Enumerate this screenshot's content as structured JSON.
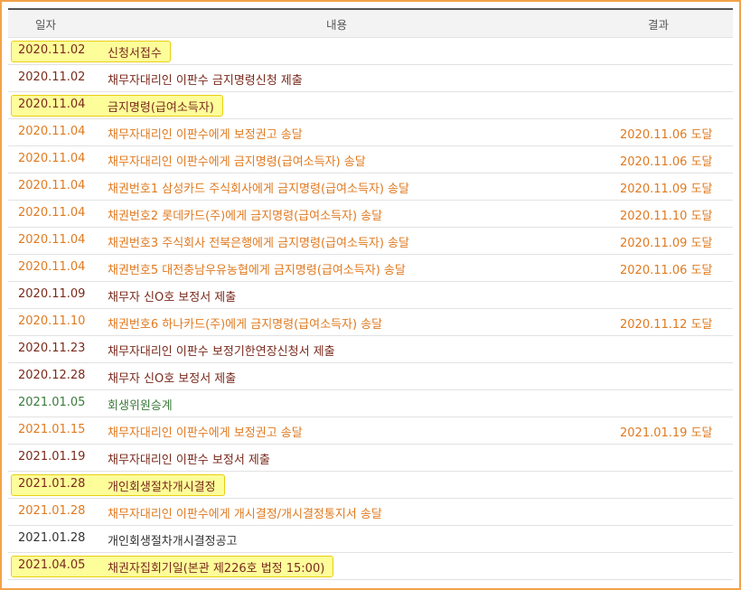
{
  "header": {
    "date": "일자",
    "content": "내용",
    "result": "결과"
  },
  "rows": [
    {
      "date": "2020.11.02",
      "content": "신청서접수",
      "result": "",
      "tone": "dark",
      "highlight": true
    },
    {
      "date": "2020.11.02",
      "content": "채무자대리인 이판수 금지명령신청 제출",
      "result": "",
      "tone": "dark",
      "highlight": false
    },
    {
      "date": "2020.11.04",
      "content": "금지명령(급여소득자)",
      "result": "",
      "tone": "dark",
      "highlight": true
    },
    {
      "date": "2020.11.04",
      "content": "채무자대리인 이판수에게 보정권고 송달",
      "result": "2020.11.06 도달",
      "tone": "orange",
      "highlight": false
    },
    {
      "date": "2020.11.04",
      "content": "채무자대리인 이판수에게 금지명령(급여소득자) 송달",
      "result": "2020.11.06 도달",
      "tone": "orange",
      "highlight": false
    },
    {
      "date": "2020.11.04",
      "content": "채권번호1 삼성카드 주식회사에게 금지명령(급여소득자) 송달",
      "result": "2020.11.09 도달",
      "tone": "orange",
      "highlight": false
    },
    {
      "date": "2020.11.04",
      "content": "채권번호2 롯데카드(주)에게 금지명령(급여소득자) 송달",
      "result": "2020.11.10 도달",
      "tone": "orange",
      "highlight": false
    },
    {
      "date": "2020.11.04",
      "content": "채권번호3 주식회사 전북은행에게 금지명령(급여소득자) 송달",
      "result": "2020.11.09 도달",
      "tone": "orange",
      "highlight": false
    },
    {
      "date": "2020.11.04",
      "content": "채권번호5 대전충남우유농협에게 금지명령(급여소득자) 송달",
      "result": "2020.11.06 도달",
      "tone": "orange",
      "highlight": false
    },
    {
      "date": "2020.11.09",
      "content": "채무자 신O호 보정서 제출",
      "result": "",
      "tone": "dark",
      "highlight": false
    },
    {
      "date": "2020.11.10",
      "content": "채권번호6 하나카드(주)에게 금지명령(급여소득자) 송달",
      "result": "2020.11.12 도달",
      "tone": "orange",
      "highlight": false
    },
    {
      "date": "2020.11.23",
      "content": "채무자대리인 이판수 보정기한연장신청서 제출",
      "result": "",
      "tone": "dark",
      "highlight": false
    },
    {
      "date": "2020.12.28",
      "content": "채무자 신O호 보정서 제출",
      "result": "",
      "tone": "dark",
      "highlight": false
    },
    {
      "date": "2021.01.05",
      "content": "회생위원승계",
      "result": "",
      "tone": "green",
      "highlight": false
    },
    {
      "date": "2021.01.15",
      "content": "채무자대리인 이판수에게 보정권고 송달",
      "result": "2021.01.19 도달",
      "tone": "orange",
      "highlight": false
    },
    {
      "date": "2021.01.19",
      "content": "채무자대리인 이판수 보정서 제출",
      "result": "",
      "tone": "dark",
      "highlight": false
    },
    {
      "date": "2021.01.28",
      "content": "개인회생절차개시결정",
      "result": "",
      "tone": "dark",
      "highlight": true
    },
    {
      "date": "2021.01.28",
      "content": "채무자대리인 이판수에게 개시결정/개시결정통지서 송달",
      "result": "",
      "tone": "orange",
      "highlight": false
    },
    {
      "date": "2021.01.28",
      "content": "개인회생절차개시결정공고",
      "result": "",
      "tone": "black",
      "highlight": false
    },
    {
      "date": "2021.04.05",
      "content": "채권자집회기일(본관 제226호 법정 15:00)",
      "result": "",
      "tone": "dark",
      "highlight": true
    }
  ]
}
